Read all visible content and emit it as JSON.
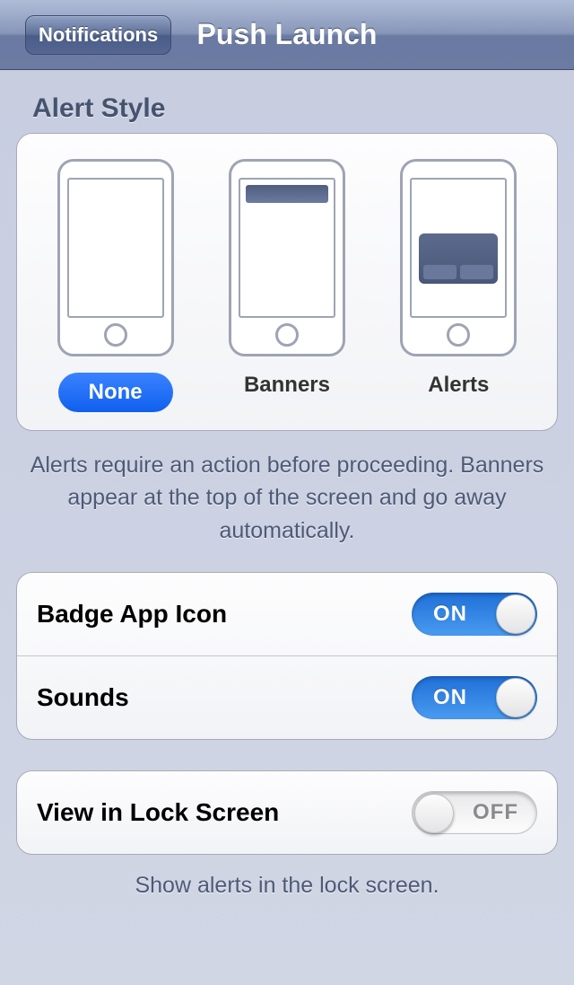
{
  "navbar": {
    "back_label": "Notifications",
    "title": "Push Launch"
  },
  "alert_style": {
    "header": "Alert Style",
    "options": [
      {
        "label": "None",
        "selected": true
      },
      {
        "label": "Banners",
        "selected": false
      },
      {
        "label": "Alerts",
        "selected": false
      }
    ],
    "description": "Alerts require an action before proceeding. Banners appear at the top of the screen and go away automatically."
  },
  "settings_group_1": [
    {
      "label": "Badge App Icon",
      "value": true,
      "on_text": "ON",
      "off_text": "OFF"
    },
    {
      "label": "Sounds",
      "value": true,
      "on_text": "ON",
      "off_text": "OFF"
    }
  ],
  "settings_group_2": [
    {
      "label": "View in Lock Screen",
      "value": false,
      "on_text": "ON",
      "off_text": "OFF"
    }
  ],
  "lock_screen_footer": "Show alerts in the lock screen."
}
